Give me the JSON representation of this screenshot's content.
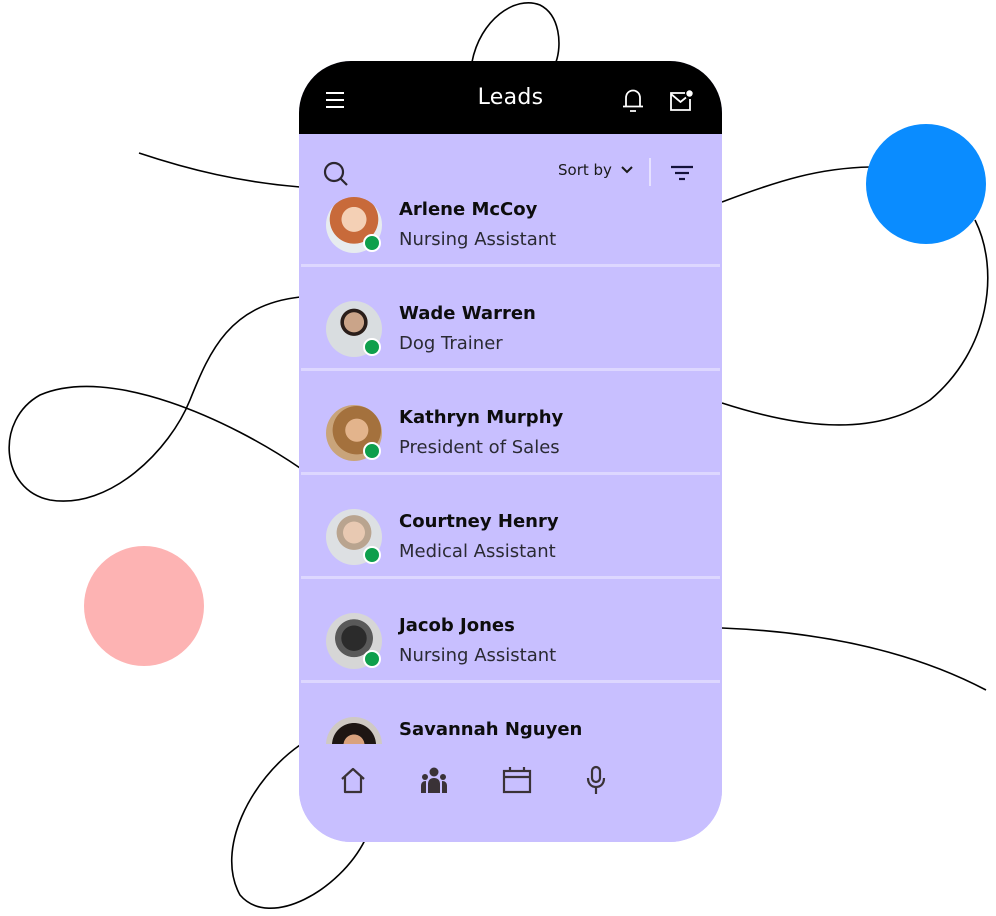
{
  "colors": {
    "panel": "#c8bfff",
    "header": "#000000",
    "accent_blue": "#0a8cff",
    "accent_pink": "#fdb3b3",
    "online": "#0e9f4c",
    "icon": "#3a3237"
  },
  "header": {
    "title": "Leads",
    "menu_icon": "hamburger-menu-icon",
    "notification_icon": "bell-icon",
    "mail_icon": "mail-icon-with-badge"
  },
  "toolbar": {
    "search_icon": "search-icon",
    "sort_label": "Sort by",
    "sort_icon": "chevron-down-icon",
    "filter_icon": "filter-icon"
  },
  "leads": [
    {
      "name": "Arlene McCoy",
      "role": "Nursing Assistant",
      "status": "online"
    },
    {
      "name": "Wade Warren",
      "role": "Dog Trainer",
      "status": "online"
    },
    {
      "name": "Kathryn Murphy",
      "role": "President of Sales",
      "status": "online"
    },
    {
      "name": "Courtney Henry",
      "role": "Medical Assistant",
      "status": "online"
    },
    {
      "name": "Jacob Jones",
      "role": "Nursing Assistant",
      "status": "online"
    },
    {
      "name": "Savannah Nguyen",
      "role": "",
      "status": "online"
    }
  ],
  "bottom_nav": [
    {
      "id": "home",
      "icon": "home-icon"
    },
    {
      "id": "contacts",
      "icon": "people-icon"
    },
    {
      "id": "calendar",
      "icon": "calendar-icon"
    },
    {
      "id": "voice",
      "icon": "microphone-icon"
    }
  ]
}
